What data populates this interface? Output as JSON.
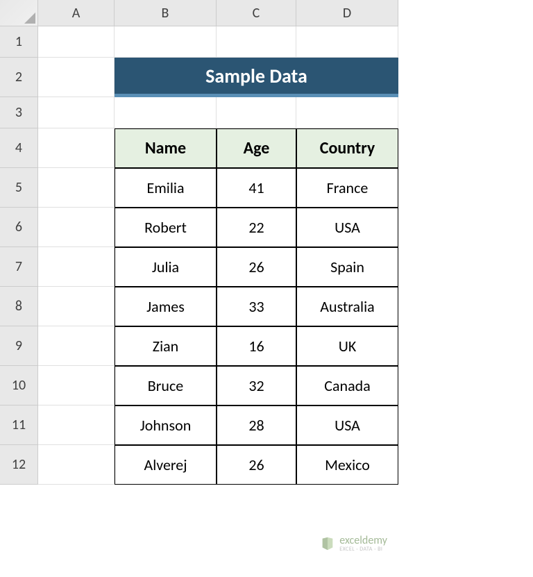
{
  "columns": [
    "A",
    "B",
    "C",
    "D"
  ],
  "rows": [
    "1",
    "2",
    "3",
    "4",
    "5",
    "6",
    "7",
    "8",
    "9",
    "10",
    "11",
    "12"
  ],
  "title": "Sample Data",
  "table": {
    "headers": [
      "Name",
      "Age",
      "Country"
    ],
    "data": [
      {
        "name": "Emilia",
        "age": "41",
        "country": "France"
      },
      {
        "name": "Robert",
        "age": "22",
        "country": "USA"
      },
      {
        "name": "Julia",
        "age": "26",
        "country": "Spain"
      },
      {
        "name": "James",
        "age": "33",
        "country": "Australia"
      },
      {
        "name": "Zian",
        "age": "16",
        "country": "UK"
      },
      {
        "name": "Bruce",
        "age": "32",
        "country": "Canada"
      },
      {
        "name": "Johnson",
        "age": "28",
        "country": "USA"
      },
      {
        "name": "Alverej",
        "age": "26",
        "country": "Mexico"
      }
    ]
  },
  "watermark": {
    "name": "exceldemy",
    "sub": "EXCEL · DATA · BI"
  },
  "chart_data": {
    "type": "table",
    "title": "Sample Data",
    "columns": [
      "Name",
      "Age",
      "Country"
    ],
    "rows": [
      [
        "Emilia",
        41,
        "France"
      ],
      [
        "Robert",
        22,
        "USA"
      ],
      [
        "Julia",
        26,
        "Spain"
      ],
      [
        "James",
        33,
        "Australia"
      ],
      [
        "Zian",
        16,
        "UK"
      ],
      [
        "Bruce",
        32,
        "Canada"
      ],
      [
        "Johnson",
        28,
        "USA"
      ],
      [
        "Alverej",
        26,
        "Mexico"
      ]
    ]
  }
}
